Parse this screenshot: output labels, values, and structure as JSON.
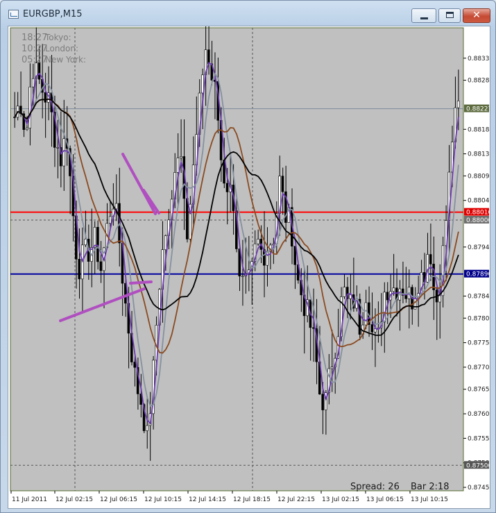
{
  "window": {
    "title": "EURGBP,M15",
    "buttons": {
      "minimize": "minimize",
      "maximize": "maximize",
      "close": "✕"
    }
  },
  "chart_data": {
    "type": "candlestick",
    "symbol": "EURGBP",
    "timeframe": "M15",
    "sessions": [
      {
        "time": "18:27",
        "name": "Tokyo:"
      },
      {
        "time": "10:27",
        "name": "London:"
      },
      {
        "time": "05:27",
        "name": "New York:"
      }
    ],
    "y_ticks": [
      "0.88330",
      "0.88285",
      "0.88185",
      "0.88135",
      "0.88090",
      "0.88040",
      "0.87945",
      "0.87845",
      "0.87800",
      "0.87750",
      "0.87700",
      "0.87655",
      "0.87605",
      "0.87555",
      "0.87505",
      "0.87455"
    ],
    "y_ticks_values": [
      0.8833,
      0.88285,
      0.88185,
      0.88135,
      0.8809,
      0.8804,
      0.87945,
      0.87845,
      0.878,
      0.8775,
      0.877,
      0.87655,
      0.87605,
      0.87555,
      0.87505,
      0.87455
    ],
    "ylim": [
      0.87448,
      0.88392
    ],
    "x_ticks": [
      "11 Jul 2011",
      "12 Jul 02:15",
      "12 Jul 06:15",
      "12 Jul 10:15",
      "12 Jul 14:15",
      "12 Jul 18:15",
      "12 Jul 22:15",
      "13 Jul 02:15",
      "13 Jul 06:15",
      "13 Jul 10:15"
    ],
    "price_labels": [
      {
        "text": "0.88227",
        "value": 0.88227,
        "color": "#5d6b3e"
      },
      {
        "text": "0.88016",
        "value": 0.88016,
        "color": "#e00000"
      },
      {
        "text": "0.88000",
        "value": 0.88,
        "color": "#707070"
      },
      {
        "text": "0.87890",
        "value": 0.8789,
        "color": "#00008b"
      },
      {
        "text": "0.87500",
        "value": 0.875,
        "color": "#555555"
      }
    ],
    "horizontal_lines": [
      {
        "value": 0.88016,
        "color": "#ff0000"
      },
      {
        "value": 0.8789,
        "color": "#0000a0"
      },
      {
        "value": 0.88227,
        "color": "#7c8a99"
      },
      {
        "value": 0.88,
        "color": "#555555",
        "dashed": true
      },
      {
        "value": 0.875,
        "color": "#555555",
        "dashed": true
      }
    ],
    "close_path": [
      0.8821,
      0.88245,
      0.8817,
      0.8832,
      0.8829,
      0.8826,
      0.8824,
      0.8817,
      0.88125,
      0.8818,
      0.8803,
      0.879,
      0.8793,
      0.8794,
      0.8796,
      0.879,
      0.8798,
      0.8805,
      0.8798,
      0.8785,
      0.8776,
      0.8767,
      0.8763,
      0.87555,
      0.8768,
      0.8786,
      0.8797,
      0.8799,
      0.8815,
      0.8813,
      0.8798,
      0.881,
      0.8822,
      0.8836,
      0.883,
      0.8825,
      0.881,
      0.8807,
      0.8804,
      0.8787,
      0.8786,
      0.8788,
      0.8796,
      0.8793,
      0.8795,
      0.8797,
      0.8808,
      0.8801,
      0.8799,
      0.8788,
      0.8784,
      0.878,
      0.8775,
      0.8764,
      0.8763,
      0.8771,
      0.8777,
      0.8786,
      0.8782,
      0.8784,
      0.8778,
      0.8786,
      0.8777,
      0.8775,
      0.8785,
      0.8787,
      0.8786,
      0.8787,
      0.8785,
      0.8784,
      0.8788,
      0.8789,
      0.8796,
      0.8782,
      0.8789,
      0.8802,
      0.8818,
      0.8823
    ],
    "moving_averages": [
      {
        "name": "",
        "color": "#6c3cb0",
        "period": 3
      },
      {
        "name": "",
        "color": "#8591a0",
        "period": 6
      },
      {
        "name": "",
        "color": "#8a4a20",
        "period": 14
      },
      {
        "name": "",
        "color": "#000000",
        "period": 22
      }
    ],
    "vertical_gridlines_x_index": [
      1,
      2,
      3,
      4,
      5,
      6,
      7,
      8,
      9
    ],
    "status": {
      "spread": "Spread: 26",
      "bar": "Bar  2:18"
    },
    "annotations": [
      {
        "type": "arrow",
        "color": "#b04fc0"
      },
      {
        "type": "arrow",
        "color": "#b04fc0"
      }
    ],
    "grid": false,
    "colors": {
      "background": "#c0c0c0",
      "bull_candle": "#ffffff",
      "bear_candle": "#000000",
      "wick": "#000000",
      "axis_text": "#1a1a1a",
      "frame": "#556b2f"
    }
  }
}
